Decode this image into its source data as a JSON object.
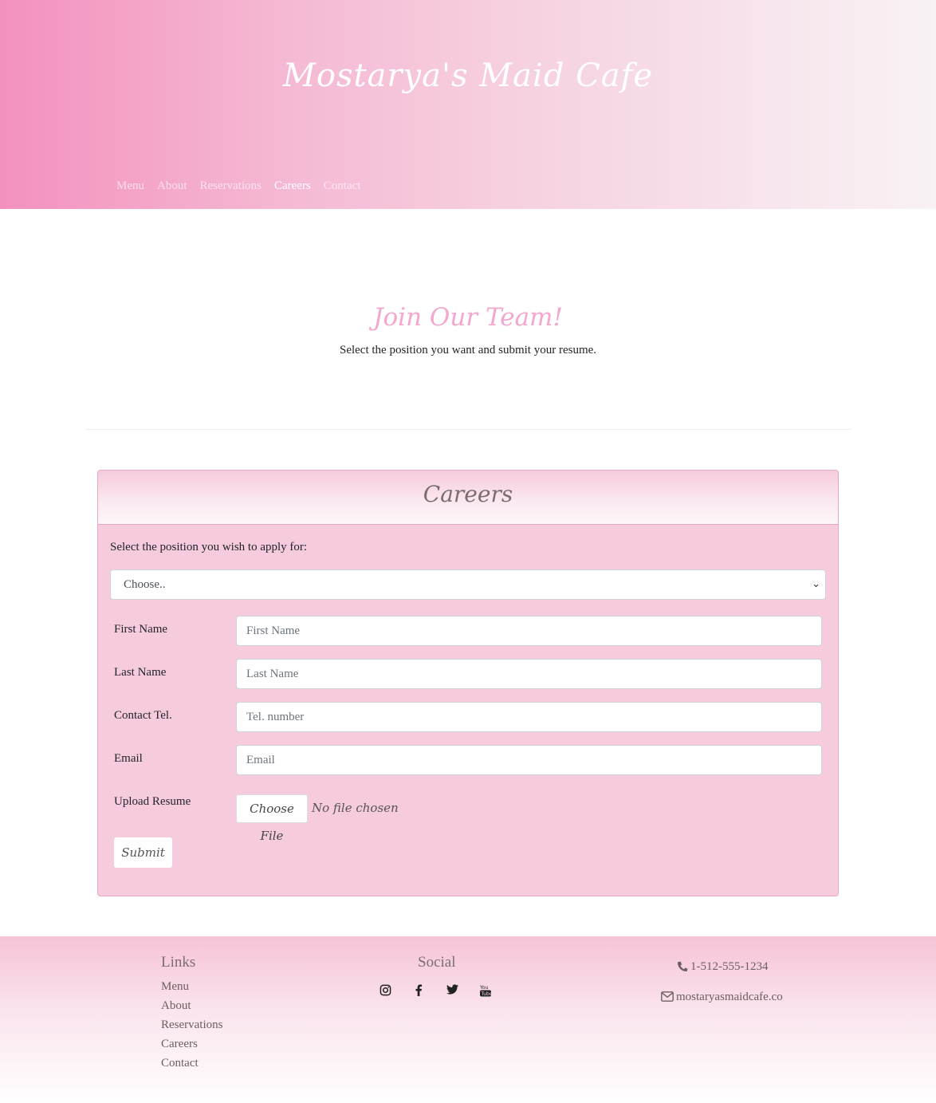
{
  "header": {
    "site_title": "Mostarya's Maid Cafe",
    "nav": [
      "Menu",
      "About",
      "Reservations",
      "Careers",
      "Contact"
    ],
    "active_nav": "Careers"
  },
  "hero": {
    "title": "Join Our Team!",
    "subtitle": "Select the position you want and submit your resume."
  },
  "form": {
    "card_title": "Careers",
    "select_label": "Select the position you wish to apply for:",
    "select_value": "Choose..",
    "fields": [
      {
        "label": "First Name",
        "placeholder": "First Name"
      },
      {
        "label": "Last Name",
        "placeholder": "Last Name"
      },
      {
        "label": "Contact Tel.",
        "placeholder": "Tel. number"
      },
      {
        "label": "Email",
        "placeholder": "Email"
      }
    ],
    "upload_label": "Upload Resume",
    "file_button": "Choose File",
    "file_status": "No file chosen",
    "submit_label": "Submit"
  },
  "footer": {
    "links_title": "Links",
    "links": [
      "Menu",
      "About",
      "Reservations",
      "Careers",
      "Contact"
    ],
    "social_title": "Social",
    "social_icons": [
      "instagram-icon",
      "facebook-icon",
      "twitter-icon",
      "youtube-icon"
    ],
    "phone": "1-512-555-1234",
    "email": "mostaryasmaidcafe.co"
  },
  "colors": {
    "header_gradient_start": "#f391bd",
    "header_gradient_end": "#f8f2f4",
    "accent_pink": "#f4a6cc",
    "card_bg": "#f6cbdd"
  }
}
